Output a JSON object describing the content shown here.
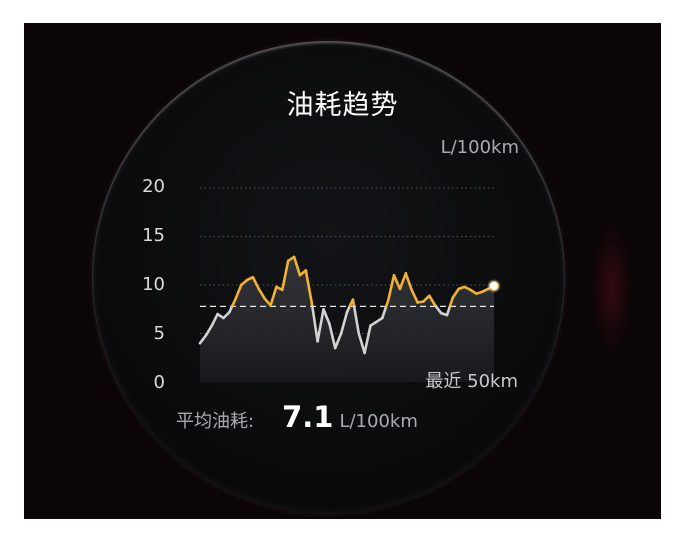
{
  "title": "油耗趋势",
  "unit": "L/100km",
  "range_label": "最近 50km",
  "average": {
    "label": "平均油耗:",
    "value": "7.1",
    "unit": "L/100km"
  },
  "colors": {
    "above_avg": "#f2b234",
    "below_avg": "#d2d2d2",
    "endpoint": "#ffffff"
  },
  "chart_data": {
    "type": "line",
    "ylim": [
      0,
      20
    ],
    "yticks": [
      0,
      5,
      10,
      15,
      20
    ],
    "ytick_labels": [
      "0",
      "5",
      "10",
      "15",
      "20"
    ],
    "y_unit": "L/100km",
    "xlabel": "最近 50km",
    "grid": true,
    "reference_line": 7.8,
    "average": 7.1,
    "x": [
      0,
      1,
      2,
      3,
      4,
      5,
      6,
      7,
      8,
      9,
      10,
      11,
      12,
      13,
      14,
      15,
      16,
      17,
      18,
      19,
      20,
      21,
      22,
      23,
      24,
      25,
      26,
      27,
      28,
      29,
      30,
      31,
      32,
      33,
      34,
      35,
      36,
      37,
      38,
      39,
      40,
      41,
      42,
      43,
      44,
      45,
      46,
      47,
      48,
      49,
      50
    ],
    "series": [
      {
        "values": [
          4,
          4.8,
          5.8,
          7,
          6.6,
          7.2,
          8.5,
          10,
          10.5,
          10.8,
          9.6,
          8.6,
          7.9,
          9.8,
          9.5,
          12.5,
          12.9,
          11,
          11.5,
          8.2,
          4.2,
          7.5,
          6,
          3.5,
          5,
          7.2,
          8.5,
          5,
          3,
          5.8,
          6.2,
          6.6,
          8.4,
          11,
          9.6,
          11.2,
          9.5,
          8.2,
          8.3,
          8.9,
          7.9,
          7.1,
          6.9,
          8.7,
          9.6,
          9.8,
          9.5,
          9.1,
          9.3,
          9.6,
          9.9
        ]
      }
    ]
  }
}
